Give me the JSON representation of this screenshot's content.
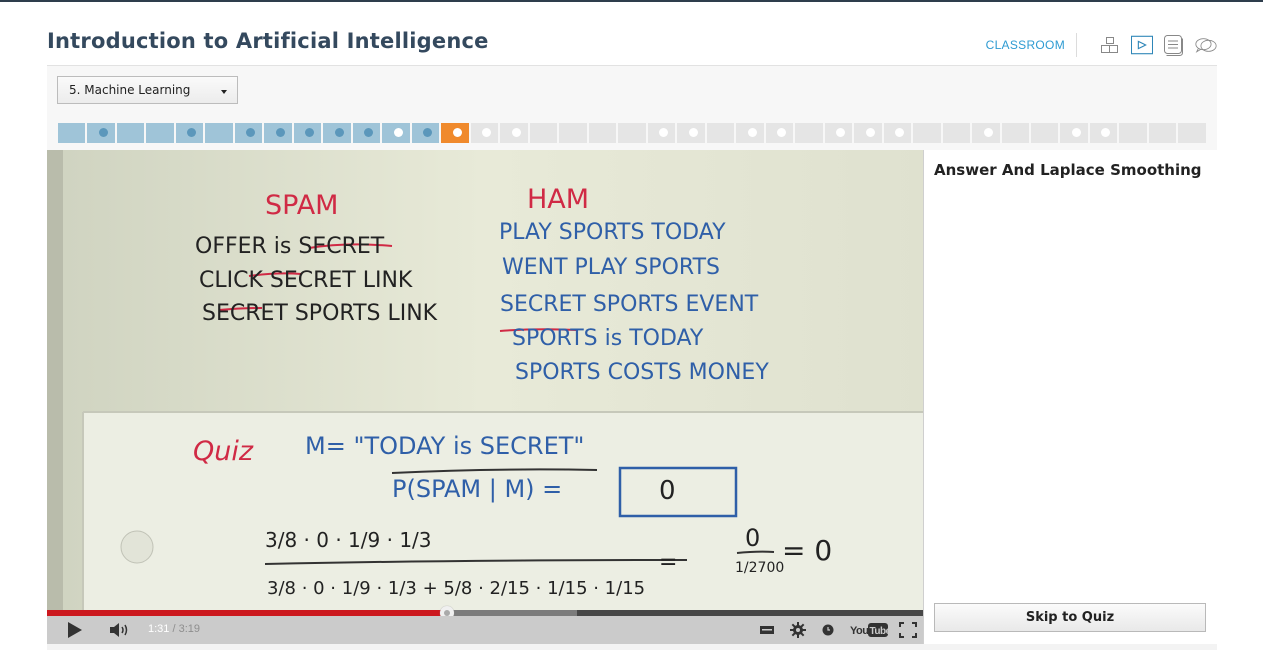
{
  "header": {
    "course_title": "Introduction to Artificial Intelligence",
    "classroom_label": "CLASSROOM",
    "nav_icons": [
      "course-map-icon",
      "video-icon",
      "notes-icon",
      "discussion-icon"
    ],
    "active_icon": "video-icon",
    "accent_color": "#2e9bd2"
  },
  "lesson_selector": {
    "selected": "5. Machine Learning"
  },
  "segments": {
    "total": 39,
    "current_index": 13,
    "completed_through": 12,
    "dots": [
      {
        "index": 1,
        "type": "done"
      },
      {
        "index": 4,
        "type": "done"
      },
      {
        "index": 6,
        "type": "done"
      },
      {
        "index": 7,
        "type": "done"
      },
      {
        "index": 8,
        "type": "done"
      },
      {
        "index": 9,
        "type": "done"
      },
      {
        "index": 10,
        "type": "done"
      },
      {
        "index": 11,
        "type": "quiz"
      },
      {
        "index": 12,
        "type": "done"
      },
      {
        "index": 13,
        "type": "quiz"
      },
      {
        "index": 14,
        "type": "quiz"
      },
      {
        "index": 15,
        "type": "quiz"
      },
      {
        "index": 20,
        "type": "quiz"
      },
      {
        "index": 21,
        "type": "quiz"
      },
      {
        "index": 23,
        "type": "quiz"
      },
      {
        "index": 24,
        "type": "quiz"
      },
      {
        "index": 26,
        "type": "quiz"
      },
      {
        "index": 27,
        "type": "quiz"
      },
      {
        "index": 28,
        "type": "quiz"
      },
      {
        "index": 31,
        "type": "quiz"
      },
      {
        "index": 34,
        "type": "quiz"
      },
      {
        "index": 35,
        "type": "quiz"
      }
    ],
    "colors": {
      "done": "#9fc4d8",
      "current": "#f08a2c",
      "pending": "#e5e5e5"
    }
  },
  "video": {
    "board": {
      "spam_heading": "SPAM",
      "ham_heading": "HAM",
      "spam_lines": [
        "OFFER is SECRET",
        "CLICK SECRET LINK",
        "SECRET SPORTS LINK"
      ],
      "ham_lines": [
        "PLAY SPORTS TODAY",
        "WENT PLAY SPORTS",
        "SECRET SPORTS EVENT",
        "SPORTS is TODAY",
        "SPORTS COSTS MONEY"
      ],
      "quiz_label": "Quiz",
      "message": "M= \"TODAY is SECRET\"",
      "question": "P(SPAM | M) =",
      "answer": "0",
      "numerator": "3/8 · 0 · 1/9 · 1/3",
      "denominator": "3/8 · 0 · 1/9 · 1/3 + 5/8 · 2/15 · 1/15 · 1/15",
      "equals_fraction_num": "0",
      "equals_fraction_den": "1/2700",
      "result": "= 0"
    },
    "player": {
      "current_time": "1:31",
      "separator": " / ",
      "duration": "3:19",
      "played_fraction": 0.457,
      "buffered_fraction": 0.605,
      "played_color": "#cc181e",
      "youtube_label": "YouTube"
    }
  },
  "sidebar": {
    "title": "Answer And Laplace Smoothing",
    "skip_button": "Skip to Quiz"
  }
}
